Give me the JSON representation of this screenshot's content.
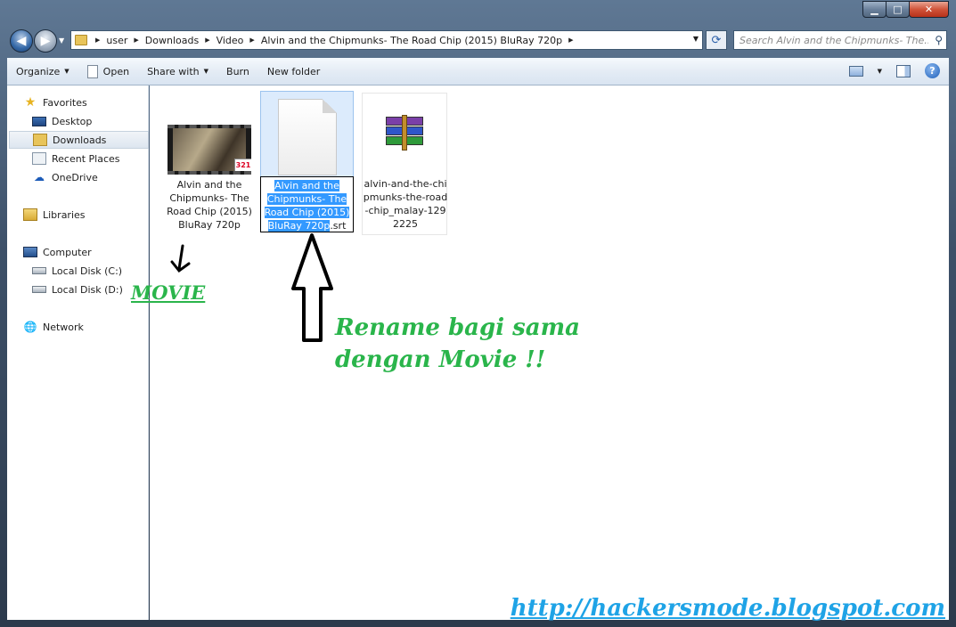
{
  "window": {
    "caption_buttons": {
      "minimize": "▁",
      "maximize": "□",
      "close": "✕"
    }
  },
  "nav": {
    "back_glyph": "◀",
    "forward_glyph": "▶",
    "dropdown_glyph": "▼",
    "breadcrumbs": [
      {
        "label": "user"
      },
      {
        "label": "Downloads"
      },
      {
        "label": "Video"
      },
      {
        "label": "Alvin and the Chipmunks- The Road Chip (2015) BluRay 720p"
      }
    ],
    "breadcrumb_separator": "▶",
    "refresh_glyph": "⟳",
    "search_placeholder": "Search Alvin and the Chipmunks- The...",
    "search_glyph": "⚲"
  },
  "toolbar": {
    "organize": "Organize",
    "open": "Open",
    "share_with": "Share with",
    "burn": "Burn",
    "new_folder": "New folder",
    "help": "?",
    "arrow": "▼"
  },
  "sidebar": {
    "favorites": "Favorites",
    "desktop": "Desktop",
    "downloads": "Downloads",
    "recent_places": "Recent Places",
    "onedrive": "OneDrive",
    "libraries": "Libraries",
    "computer": "Computer",
    "local_disk_c": "Local Disk (C:)",
    "local_disk_d": "Local Disk (D:)",
    "network": "Network"
  },
  "files": {
    "movie": {
      "name": "Alvin and the Chipmunks- The Road Chip (2015) BluRay 720p",
      "badge": "321"
    },
    "subtitle": {
      "selected_part": "Alvin and the Chipmunks- The Road Chip (2015) BluRay 720p",
      "extension": ".srt"
    },
    "archive": {
      "name": "alvin-and-the-chipmunks-the-road-chip_malay-1292225"
    }
  },
  "annotations": {
    "movie_label": "MOVIE",
    "rename_note_line1": "Rename bagi sama",
    "rename_note_line2": "dengan Movie !!",
    "watermark": "http://hackersmode.blogspot.com"
  },
  "colors": {
    "annotation_green": "#2ab54b",
    "watermark_blue": "#1fa3e6",
    "selection_blue": "#3399ff"
  }
}
